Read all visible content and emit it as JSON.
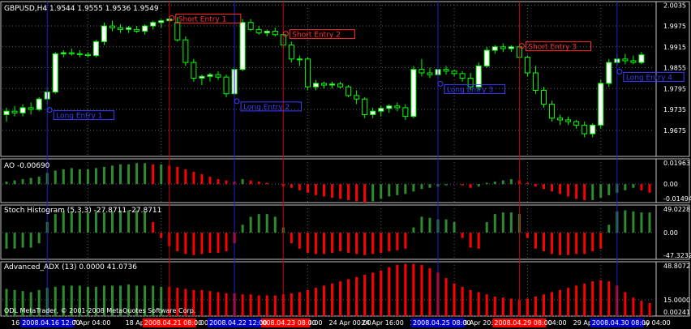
{
  "colors": {
    "background": "#000000",
    "grid": "#5a5a6e",
    "axis": "#c0c0c0",
    "bull_candle": "#ffffff",
    "bear_candle": "#000000",
    "wick": "#00ff00",
    "green_bar": "#2e8b2e",
    "red_bar": "#ff0000",
    "short_line": "#cc0000",
    "long_line": "#1e1ed2",
    "short_label": "#ff3030",
    "long_label": "#3c3cff",
    "date_highlight_red": "#ff0000",
    "date_highlight_blue": "#0000c8",
    "text": "#ffffff"
  },
  "chart_data": [
    {
      "type": "candlestick",
      "title": "GBPUSD,H4  1.9544 1.9555 1.9536 1.9549",
      "symbol": "GBPUSD,H4",
      "ohlc_header": "1.9544 1.9555 1.9536 1.9549",
      "ylim": [
        1.96,
        2.0045
      ],
      "y_ticks": [
        "2.0035",
        "1.9975",
        "1.9915",
        "1.9855",
        "1.9795",
        "1.9735",
        "1.9675"
      ],
      "candles": [
        [
          1.972,
          1.974,
          1.97,
          1.973
        ],
        [
          1.973,
          1.9745,
          1.9715,
          1.9725
        ],
        [
          1.9725,
          1.975,
          1.9715,
          1.974
        ],
        [
          1.974,
          1.9755,
          1.972,
          1.9735
        ],
        [
          1.9735,
          1.977,
          1.973,
          1.9765
        ],
        [
          1.9765,
          1.98,
          1.975,
          1.9785
        ],
        [
          1.9785,
          1.99,
          1.978,
          1.9895
        ],
        [
          1.9895,
          1.9905,
          1.9885,
          1.9898
        ],
        [
          1.9898,
          1.991,
          1.989,
          1.9895
        ],
        [
          1.9895,
          1.9905,
          1.9885,
          1.9893
        ],
        [
          1.9893,
          1.99,
          1.9885,
          1.989
        ],
        [
          1.989,
          1.9935,
          1.9885,
          1.993
        ],
        [
          1.993,
          1.9985,
          1.992,
          1.9975
        ],
        [
          1.9975,
          1.999,
          1.996,
          1.997
        ],
        [
          1.997,
          1.998,
          1.9955,
          1.9965
        ],
        [
          1.9965,
          1.9975,
          1.9955,
          1.997
        ],
        [
          1.9965,
          1.9975,
          1.9955,
          1.996
        ],
        [
          1.996,
          1.998,
          1.995,
          1.9975
        ],
        [
          1.9975,
          1.999,
          1.9965,
          1.9985
        ],
        [
          1.9985,
          1.9995,
          1.997,
          1.999
        ],
        [
          1.999,
          2.0,
          1.9985,
          1.9995
        ],
        [
          1.9985,
          2.0,
          1.993,
          1.9935
        ],
        [
          1.9935,
          1.9945,
          1.986,
          1.987
        ],
        [
          1.987,
          1.988,
          1.9815,
          1.9825
        ],
        [
          1.9825,
          1.9835,
          1.9805,
          1.983
        ],
        [
          1.983,
          1.984,
          1.9815,
          1.9835
        ],
        [
          1.9835,
          1.9845,
          1.982,
          1.9828
        ],
        [
          1.9828,
          1.9835,
          1.977,
          1.978
        ],
        [
          1.978,
          1.986,
          1.9775,
          1.985
        ],
        [
          1.985,
          1.9995,
          1.9845,
          1.9985
        ],
        [
          1.9985,
          1.9995,
          1.996,
          1.9965
        ],
        [
          1.9965,
          1.9975,
          1.995,
          1.9955
        ],
        [
          1.9955,
          1.9965,
          1.9945,
          1.996
        ],
        [
          1.996,
          1.997,
          1.9945,
          1.995
        ],
        [
          1.995,
          1.9955,
          1.991,
          1.992
        ],
        [
          1.992,
          1.993,
          1.987,
          1.988
        ],
        [
          1.988,
          1.989,
          1.986,
          1.988
        ],
        [
          1.988,
          1.9885,
          1.979,
          1.98
        ],
        [
          1.98,
          1.982,
          1.979,
          1.981
        ],
        [
          1.981,
          1.9815,
          1.9795,
          1.9805
        ],
        [
          1.9805,
          1.9815,
          1.9795,
          1.9808
        ],
        [
          1.9808,
          1.9815,
          1.9795,
          1.98
        ],
        [
          1.98,
          1.9805,
          1.977,
          1.9775
        ],
        [
          1.9775,
          1.979,
          1.975,
          1.9765
        ],
        [
          1.9765,
          1.977,
          1.971,
          1.972
        ],
        [
          1.972,
          1.974,
          1.971,
          1.973
        ],
        [
          1.973,
          1.9745,
          1.9715,
          1.9738
        ],
        [
          1.9738,
          1.975,
          1.9725,
          1.9745
        ],
        [
          1.9745,
          1.9755,
          1.973,
          1.974
        ],
        [
          1.974,
          1.975,
          1.9705,
          1.9715
        ],
        [
          1.9715,
          1.986,
          1.971,
          1.985
        ],
        [
          1.985,
          1.988,
          1.983,
          1.984
        ],
        [
          1.984,
          1.9855,
          1.9825,
          1.9835
        ],
        [
          1.9835,
          1.9855,
          1.9825,
          1.985
        ],
        [
          1.985,
          1.986,
          1.9835,
          1.9845
        ],
        [
          1.9845,
          1.985,
          1.983,
          1.9838
        ],
        [
          1.9838,
          1.9845,
          1.9815,
          1.9825
        ],
        [
          1.9825,
          1.984,
          1.979,
          1.98
        ],
        [
          1.98,
          1.987,
          1.979,
          1.986
        ],
        [
          1.986,
          1.9915,
          1.9855,
          1.9905
        ],
        [
          1.9905,
          1.992,
          1.9895,
          1.9915
        ],
        [
          1.9915,
          1.9925,
          1.99,
          1.991
        ],
        [
          1.991,
          1.992,
          1.99,
          1.9915
        ],
        [
          1.9915,
          1.992,
          1.988,
          1.9885
        ],
        [
          1.9885,
          1.989,
          1.983,
          1.984
        ],
        [
          1.984,
          1.986,
          1.978,
          1.979
        ],
        [
          1.979,
          1.98,
          1.974,
          1.975
        ],
        [
          1.975,
          1.976,
          1.97,
          1.971
        ],
        [
          1.971,
          1.972,
          1.969,
          1.9705
        ],
        [
          1.9705,
          1.9715,
          1.969,
          1.97
        ],
        [
          1.97,
          1.9705,
          1.968,
          1.969
        ],
        [
          1.969,
          1.97,
          1.9655,
          1.9665
        ],
        [
          1.9665,
          1.9695,
          1.9655,
          1.969
        ],
        [
          1.969,
          1.982,
          1.968,
          1.981
        ],
        [
          1.981,
          1.988,
          1.98,
          1.987
        ],
        [
          1.987,
          1.9895,
          1.986,
          1.988
        ],
        [
          1.988,
          1.9895,
          1.9865,
          1.9875
        ],
        [
          1.9875,
          1.989,
          1.9865,
          1.987
        ],
        [
          1.987,
          1.99,
          1.9865,
          1.9892
        ]
      ],
      "signals": [
        {
          "kind": "short",
          "label": "Short Entry 1",
          "candle": 20
        },
        {
          "kind": "short",
          "label": "Short Entry 2",
          "candle": 34
        },
        {
          "kind": "short",
          "label": "Short Entry 3",
          "candle": 63
        },
        {
          "kind": "long",
          "label": "Long Entry 1",
          "candle": 5
        },
        {
          "kind": "long",
          "label": "Long Entry 2",
          "candle": 28
        },
        {
          "kind": "long",
          "label": "Long Entry 3",
          "candle": 53
        },
        {
          "kind": "long",
          "label": "Long Entry 4",
          "candle": 75
        }
      ]
    },
    {
      "type": "bar",
      "title": "AO -0.00690",
      "ylim": [
        -0.015,
        0.0205
      ],
      "y_ticks": [
        "0.01963",
        "0.00",
        "-0.01494"
      ],
      "values": [
        0.002,
        0.003,
        0.004,
        0.005,
        0.006,
        0.009,
        0.011,
        0.012,
        0.013,
        0.012,
        0.012,
        0.013,
        0.014,
        0.015,
        0.016,
        0.016,
        0.017,
        0.017,
        0.016,
        0.016,
        0.015,
        0.014,
        0.012,
        0.01,
        0.008,
        0.006,
        0.004,
        0.003,
        0.002,
        0.004,
        0.003,
        0.002,
        0.001,
        0.0,
        -0.002,
        -0.003,
        -0.005,
        -0.007,
        -0.009,
        -0.01,
        -0.011,
        -0.012,
        -0.013,
        -0.014,
        -0.015,
        -0.014,
        -0.012,
        -0.01,
        -0.009,
        -0.008,
        -0.006,
        -0.004,
        -0.003,
        -0.002,
        -0.001,
        0.0,
        -0.001,
        -0.003,
        -0.002,
        0.001,
        0.002,
        0.003,
        0.004,
        0.003,
        0.001,
        -0.002,
        -0.004,
        -0.006,
        -0.008,
        -0.01,
        -0.012,
        -0.013,
        -0.013,
        -0.011,
        -0.009,
        -0.007,
        -0.005,
        -0.003,
        -0.005,
        -0.007
      ],
      "colors": [
        "g",
        "g",
        "g",
        "g",
        "g",
        "g",
        "g",
        "g",
        "g",
        "g",
        "g",
        "g",
        "g",
        "g",
        "g",
        "g",
        "g",
        "g",
        "r",
        "g",
        "r",
        "r",
        "r",
        "r",
        "r",
        "r",
        "r",
        "r",
        "r",
        "g",
        "r",
        "r",
        "r",
        "r",
        "r",
        "r",
        "r",
        "r",
        "r",
        "r",
        "r",
        "r",
        "r",
        "r",
        "r",
        "g",
        "g",
        "g",
        "g",
        "g",
        "g",
        "g",
        "g",
        "g",
        "g",
        "g",
        "r",
        "r",
        "g",
        "g",
        "g",
        "g",
        "g",
        "r",
        "r",
        "r",
        "r",
        "r",
        "r",
        "r",
        "r",
        "r",
        "g",
        "g",
        "g",
        "g",
        "g",
        "g",
        "r",
        "r"
      ]
    },
    {
      "type": "bar",
      "title": "Stoch Histogram (5,3,3) -27.8711 -27.8711",
      "ylim": [
        -50,
        52
      ],
      "y_ticks": [
        "49.0228",
        "0.00",
        "-47.3232"
      ],
      "values": [
        -30,
        -30,
        -28,
        -28,
        -20,
        20,
        35,
        40,
        40,
        38,
        38,
        40,
        38,
        40,
        42,
        42,
        42,
        40,
        20,
        -10,
        -25,
        -35,
        -40,
        -42,
        -40,
        -38,
        -38,
        -35,
        -20,
        15,
        30,
        35,
        35,
        30,
        10,
        -20,
        -30,
        -38,
        -40,
        -40,
        -38,
        -35,
        -38,
        -40,
        -42,
        -40,
        -38,
        -35,
        -33,
        -30,
        10,
        30,
        28,
        25,
        25,
        20,
        -10,
        -28,
        -30,
        20,
        35,
        38,
        38,
        35,
        -10,
        -30,
        -35,
        -40,
        -42,
        -42,
        -40,
        -40,
        -35,
        -30,
        15,
        40,
        42,
        40,
        38,
        38
      ],
      "colors": [
        "g",
        "g",
        "g",
        "g",
        "g",
        "g",
        "g",
        "g",
        "g",
        "g",
        "g",
        "g",
        "g",
        "g",
        "g",
        "g",
        "g",
        "g",
        "r",
        "r",
        "r",
        "r",
        "r",
        "r",
        "r",
        "r",
        "r",
        "r",
        "r",
        "g",
        "g",
        "g",
        "g",
        "g",
        "g",
        "r",
        "r",
        "r",
        "r",
        "r",
        "r",
        "r",
        "r",
        "r",
        "r",
        "r",
        "r",
        "r",
        "r",
        "r",
        "g",
        "g",
        "g",
        "g",
        "g",
        "g",
        "r",
        "r",
        "r",
        "g",
        "g",
        "g",
        "g",
        "g",
        "r",
        "r",
        "r",
        "r",
        "r",
        "r",
        "r",
        "r",
        "r",
        "r",
        "g",
        "g",
        "g",
        "g",
        "g",
        "g"
      ]
    },
    {
      "type": "bar",
      "title": "Advanced_ADX (13) 0.0000 41.0736",
      "ylim": [
        0,
        50
      ],
      "y_ticks": [
        "48.8072",
        "15.0000",
        "0.00241"
      ],
      "level": 15,
      "values": [
        25,
        24,
        23,
        22,
        24,
        26,
        27,
        28,
        28,
        28,
        27,
        27,
        28,
        28,
        28,
        29,
        28,
        28,
        28,
        27,
        27,
        26,
        25,
        24,
        24,
        23,
        22,
        21,
        21,
        20,
        20,
        19,
        19,
        19,
        20,
        21,
        22,
        24,
        26,
        28,
        30,
        32,
        34,
        36,
        38,
        40,
        42,
        45,
        47,
        48,
        48,
        47,
        44,
        40,
        35,
        30,
        27,
        24,
        22,
        20,
        18,
        17,
        16,
        15,
        16,
        18,
        20,
        22,
        24,
        26,
        28,
        30,
        32,
        33,
        32,
        28,
        22,
        17,
        14,
        12
      ],
      "colors": [
        "g",
        "g",
        "g",
        "g",
        "g",
        "g",
        "g",
        "g",
        "g",
        "g",
        "g",
        "g",
        "g",
        "g",
        "g",
        "g",
        "g",
        "g",
        "g",
        "g",
        "r",
        "r",
        "r",
        "r",
        "r",
        "r",
        "r",
        "r",
        "r",
        "r",
        "r",
        "r",
        "r",
        "r",
        "r",
        "r",
        "r",
        "r",
        "r",
        "r",
        "r",
        "r",
        "r",
        "r",
        "r",
        "r",
        "r",
        "r",
        "r",
        "r",
        "r",
        "r",
        "r",
        "r",
        "r",
        "r",
        "r",
        "r",
        "r",
        "r",
        "r",
        "r",
        "r",
        "r",
        "r",
        "r",
        "r",
        "r",
        "r",
        "r",
        "r",
        "r",
        "r",
        "r",
        "r",
        "r",
        "r",
        "r",
        "r",
        "r"
      ]
    }
  ],
  "x_axis_labels": [
    {
      "text": "16 Apr 2008",
      "slot": 1
    },
    {
      "text": "17 Apr 04:00",
      "slot": 8
    },
    {
      "text": "18 Apr 04:00",
      "slot": 15
    },
    {
      "text": "18 Apr 20:00",
      "slot": 20
    },
    {
      "text": "22 Apr 12:00",
      "slot": 29
    },
    {
      "text": "23 Apr 04:00",
      "slot": 34
    },
    {
      "text": "24 Apr 00:00",
      "slot": 40
    },
    {
      "text": "24 Apr 16:00",
      "slot": 44
    },
    {
      "text": "25 Apr 08:00",
      "slot": 50
    },
    {
      "text": "28 Apr 20:00",
      "slot": 56
    },
    {
      "text": "29 Apr 12:00",
      "slot": 60
    },
    {
      "text": "30 Apr 04:00",
      "slot": 64
    },
    {
      "text": "29 Apr 20:00",
      "slot": 70
    },
    {
      "text": "1 May 04:00",
      "slot": 77
    }
  ],
  "date_highlights": [
    {
      "text": "2008.04.21 08:00",
      "slot": 20,
      "kind": "short"
    },
    {
      "text": "2008.04.23 08:00",
      "slot": 34,
      "kind": "short"
    },
    {
      "text": "2008.04.29 08:00",
      "slot": 63,
      "kind": "short"
    },
    {
      "text": "2008.04.16 12:00",
      "slot": 5,
      "kind": "long"
    },
    {
      "text": "2008.04.22 12:00",
      "slot": 28,
      "kind": "long"
    },
    {
      "text": "2008.04.25 08:00",
      "slot": 53,
      "kind": "long"
    },
    {
      "text": "2008.04.30 08:00",
      "slot": 75,
      "kind": "long"
    }
  ],
  "copyright": "ODL MetaTrader, © 2001-2008 MetaQuotes Software Corp."
}
